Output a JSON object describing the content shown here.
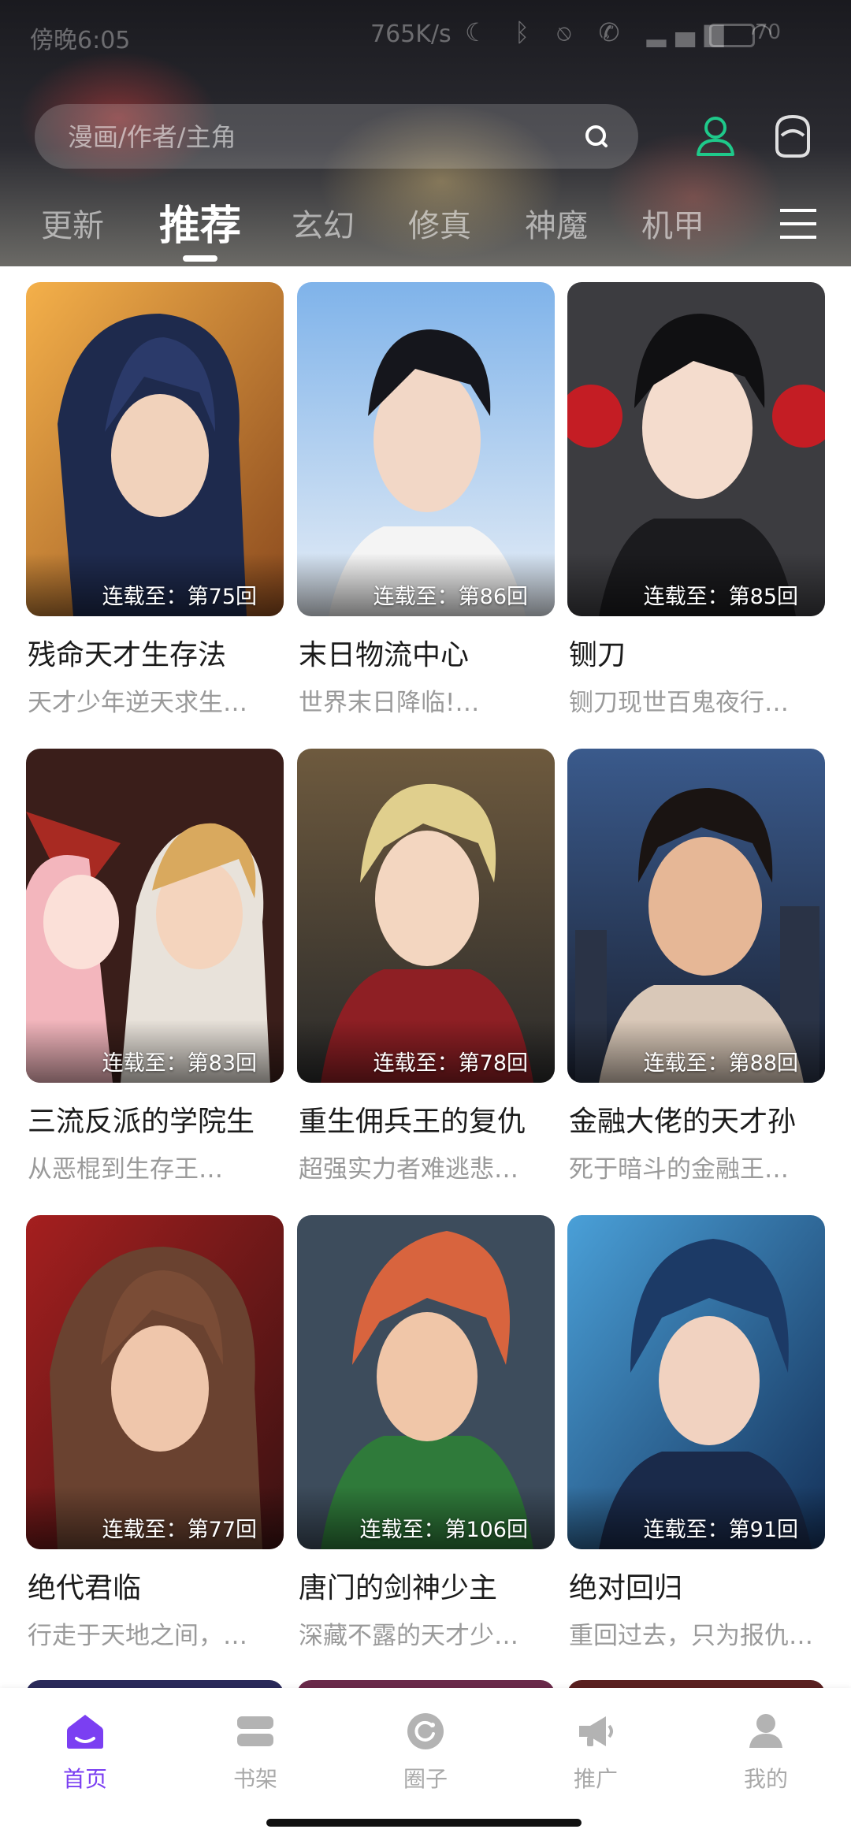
{
  "status_bar": {
    "time": "傍晚6:05",
    "network_speed": "765K/s",
    "icons": [
      "moon-icon",
      "bluetooth-icon",
      "mute-icon",
      "call-icon",
      "signal-icon",
      "wifi-icon",
      "battery-icon"
    ],
    "battery": "70"
  },
  "search": {
    "placeholder": "漫画/作者/主角"
  },
  "tabs": [
    {
      "label": "更新",
      "active": false
    },
    {
      "label": "推荐",
      "active": true
    },
    {
      "label": "玄幻",
      "active": false
    },
    {
      "label": "修真",
      "active": false
    },
    {
      "label": "神魔",
      "active": false
    },
    {
      "label": "机甲",
      "active": false
    }
  ],
  "colors": {
    "accent": "#7b3ff2",
    "user_icon": "#1fc98a"
  },
  "comics": [
    {
      "badge": "连载至：第75回",
      "title": "残命天才生存法",
      "desc": "天才少年逆天求生…"
    },
    {
      "badge": "连载至：第86回",
      "title": "末日物流中心",
      "desc": "世界末日降临!…"
    },
    {
      "badge": "连载至：第85回",
      "title": "铡刀",
      "desc": "铡刀现世百鬼夜行…"
    },
    {
      "badge": "连载至：第83回",
      "title": "三流反派的学院生",
      "desc": "从恶棍到生存王…"
    },
    {
      "badge": "连载至：第78回",
      "title": "重生佣兵王的复仇",
      "desc": "超强实力者难逃悲…"
    },
    {
      "badge": "连载至：第88回",
      "title": "金融大佬的天才孙",
      "desc": "死于暗斗的金融王…"
    },
    {
      "badge": "连载至：第77回",
      "title": "绝代君临",
      "desc": "行走于天地之间，…"
    },
    {
      "badge": "连载至：第106回",
      "title": "唐门的剑神少主",
      "desc": "深藏不露的天才少…"
    },
    {
      "badge": "连载至：第91回",
      "title": "绝对回归",
      "desc": "重回过去，只为报仇…"
    }
  ],
  "bottom_nav": [
    {
      "label": "首页",
      "icon": "home-icon",
      "active": true
    },
    {
      "label": "书架",
      "icon": "bookshelf-icon",
      "active": false
    },
    {
      "label": "圈子",
      "icon": "circle-icon",
      "active": false
    },
    {
      "label": "推广",
      "icon": "megaphone-icon",
      "active": false
    },
    {
      "label": "我的",
      "icon": "profile-icon",
      "active": false
    }
  ]
}
